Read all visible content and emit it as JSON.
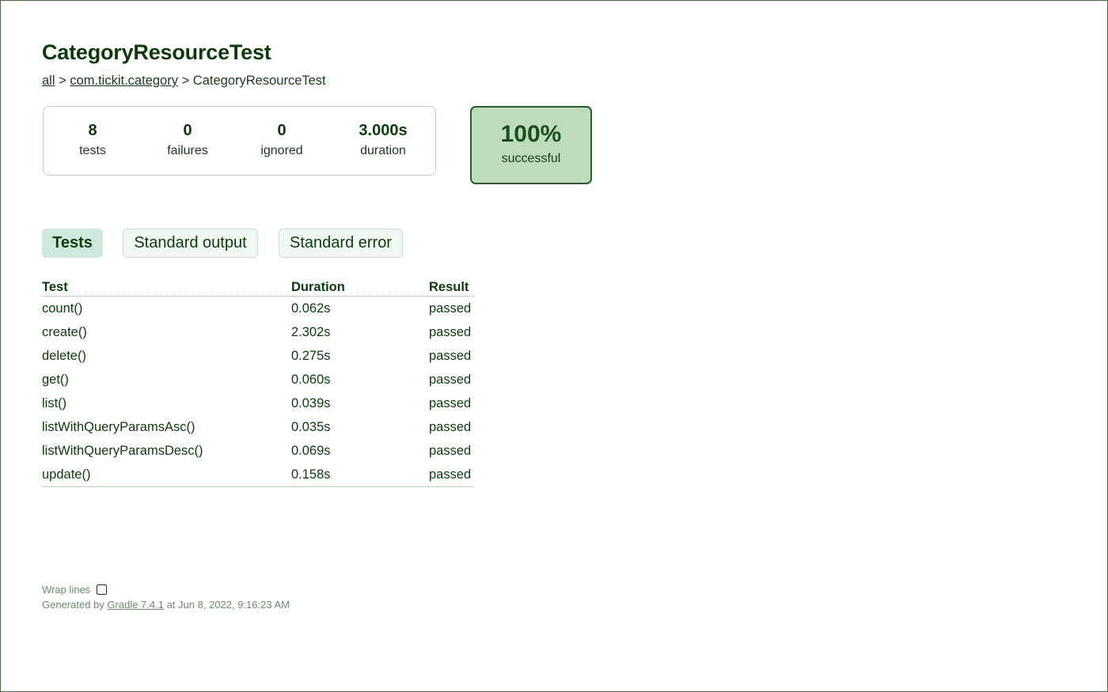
{
  "page": {
    "title": "CategoryResourceTest"
  },
  "breadcrumb": {
    "all_label": "all",
    "sep1": ">",
    "package_label": "com.tickit.category",
    "sep2": ">",
    "current": "CategoryResourceTest"
  },
  "summary": {
    "tests": {
      "value": "8",
      "label": "tests"
    },
    "failures": {
      "value": "0",
      "label": "failures"
    },
    "ignored": {
      "value": "0",
      "label": "ignored"
    },
    "duration": {
      "value": "3.000s",
      "label": "duration"
    },
    "success": {
      "value": "100%",
      "label": "successful"
    }
  },
  "tabs": [
    {
      "label": "Tests",
      "active": true
    },
    {
      "label": "Standard output",
      "active": false
    },
    {
      "label": "Standard error",
      "active": false
    }
  ],
  "table": {
    "headers": {
      "test": "Test",
      "duration": "Duration",
      "result": "Result"
    },
    "rows": [
      {
        "test": "count()",
        "duration": "0.062s",
        "result": "passed"
      },
      {
        "test": "create()",
        "duration": "2.302s",
        "result": "passed"
      },
      {
        "test": "delete()",
        "duration": "0.275s",
        "result": "passed"
      },
      {
        "test": "get()",
        "duration": "0.060s",
        "result": "passed"
      },
      {
        "test": "list()",
        "duration": "0.039s",
        "result": "passed"
      },
      {
        "test": "listWithQueryParamsAsc()",
        "duration": "0.035s",
        "result": "passed"
      },
      {
        "test": "listWithQueryParamsDesc()",
        "duration": "0.069s",
        "result": "passed"
      },
      {
        "test": "update()",
        "duration": "0.158s",
        "result": "passed"
      }
    ]
  },
  "footer": {
    "wrap_lines_label": "Wrap lines",
    "wrap_lines_checked": false,
    "generated_prefix": "Generated by",
    "gradle_link": "Gradle 7.4.1",
    "generated_suffix": "at Jun 8, 2022, 9:16:23 AM"
  },
  "colors": {
    "text": "#0b3b0b",
    "success_bg": "#bcdcbc",
    "success_border": "#2c5a2c",
    "tab_active_bg": "#cfe8dc",
    "footer_text": "#6a8c6a"
  }
}
